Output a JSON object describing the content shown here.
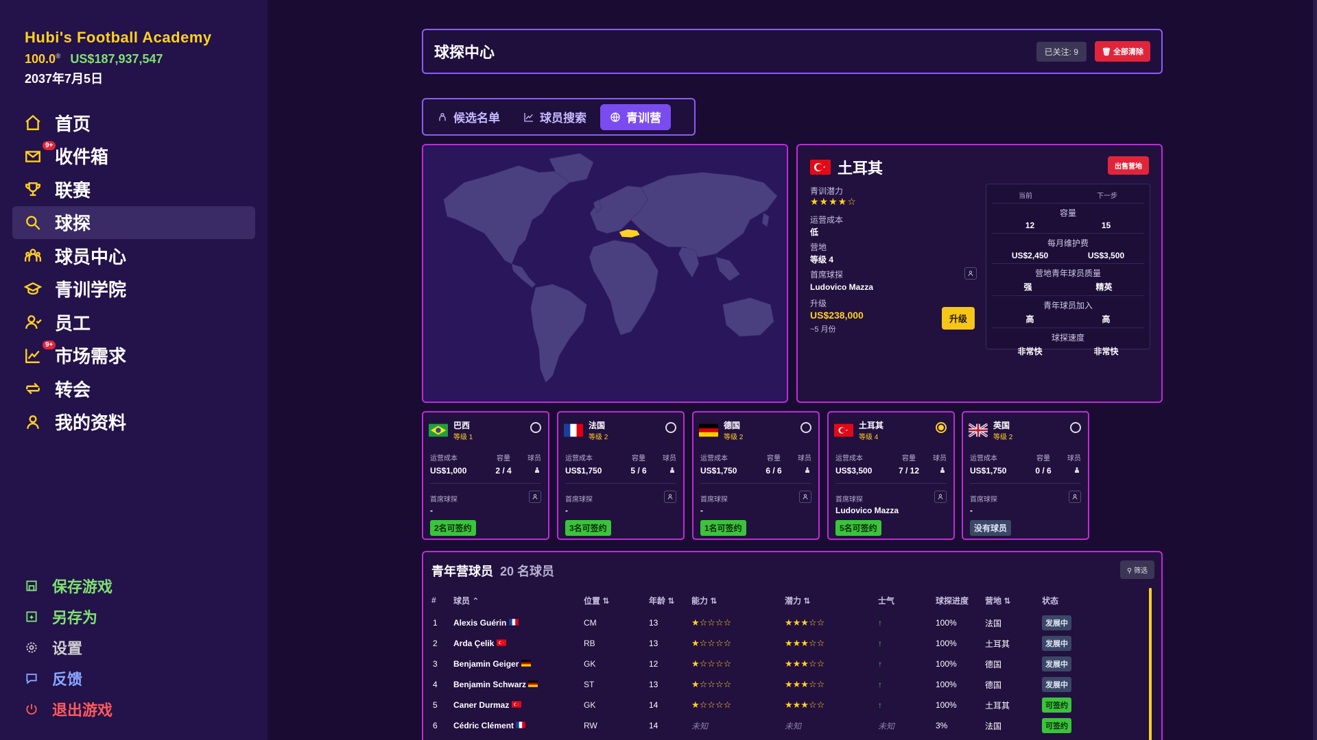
{
  "brand": {
    "title": "Hubi's Football Academy",
    "reputation": "100.0",
    "money": "US$187,937,547",
    "date": "2037年7月5日"
  },
  "nav": [
    {
      "label": "首页",
      "icon": "home-icon"
    },
    {
      "label": "收件箱",
      "icon": "mail-icon",
      "badge": "9+"
    },
    {
      "label": "联赛",
      "icon": "trophy-icon"
    },
    {
      "label": "球探",
      "icon": "search-icon",
      "active": true
    },
    {
      "label": "球员中心",
      "icon": "users-icon"
    },
    {
      "label": "青训学院",
      "icon": "graduation-icon"
    },
    {
      "label": "员工",
      "icon": "staff-icon"
    },
    {
      "label": "市场需求",
      "icon": "chart-icon",
      "badge": "9+"
    },
    {
      "label": "转会",
      "icon": "transfer-icon"
    },
    {
      "label": "我的资料",
      "icon": "profile-icon"
    }
  ],
  "bottom_nav": {
    "save": "保存游戏",
    "save_as": "另存为",
    "settings": "设置",
    "feedback": "反馈",
    "quit": "退出游戏"
  },
  "header": {
    "title": "球探中心",
    "followed": "已关注: 9",
    "clear_all": "全部清除"
  },
  "tabs": {
    "shortlist": "候选名单",
    "player_search": "球员搜索",
    "youth_camp": "青训营"
  },
  "detail": {
    "country": "土耳其",
    "sell": "出售营地",
    "potential_label": "青训潜力",
    "potential_stars": "★★★★☆",
    "cost_label": "运营成本",
    "cost_value": "低",
    "camp_label": "营地",
    "camp_value": "等级 4",
    "scout_label": "首席球探",
    "scout_value": "Ludovico Mazza",
    "upgrade_label": "升级",
    "upgrade_cost": "US$238,000",
    "upgrade_time": "~5 月份",
    "upgrade_btn": "升级",
    "cmp": {
      "current": "当前",
      "next": "下一步",
      "rows": [
        {
          "label": "容量",
          "cur": "12",
          "next": "15"
        },
        {
          "label": "每月维护费",
          "cur": "US$2,450",
          "next": "US$3,500"
        },
        {
          "label": "营地青年球员质量",
          "cur": "强",
          "next": "精英"
        },
        {
          "label": "青年球员加入",
          "cur": "高",
          "next": "高"
        },
        {
          "label": "球探速度",
          "cur": "非常快",
          "next": "非常快"
        }
      ]
    }
  },
  "card_labels": {
    "cost": "运营成本",
    "capacity": "容量",
    "players": "球员",
    "scout": "首席球探"
  },
  "cards": [
    {
      "name": "巴西",
      "level": "等级 1",
      "cost": "US$1,000",
      "capacity": "2 / 4",
      "scout": "-",
      "tag": "2名可签约",
      "tag_type": "green",
      "flag": "br"
    },
    {
      "name": "法国",
      "level": "等级 2",
      "cost": "US$1,750",
      "capacity": "5 / 6",
      "scout": "-",
      "tag": "3名可签约",
      "tag_type": "green",
      "flag": "fr"
    },
    {
      "name": "德国",
      "level": "等级 2",
      "cost": "US$1,750",
      "capacity": "6 / 6",
      "scout": "-",
      "tag": "1名可签约",
      "tag_type": "green",
      "flag": "de"
    },
    {
      "name": "土耳其",
      "level": "等级 4",
      "cost": "US$3,500",
      "capacity": "7 / 12",
      "scout": "Ludovico Mazza",
      "tag": "5名可签约",
      "tag_type": "green",
      "flag": "tr",
      "selected": true
    },
    {
      "name": "英国",
      "level": "等级 2",
      "cost": "US$1,750",
      "capacity": "0 / 6",
      "scout": "-",
      "tag": "没有球员",
      "tag_type": "gray",
      "flag": "gb"
    }
  ],
  "table": {
    "title": "青年营球员",
    "count": "20 名球员",
    "filter": "筛选",
    "headers": {
      "num": "#",
      "player": "球员 ⌃",
      "position": "位置 ⇅",
      "age": "年龄 ⇅",
      "ability": "能力 ⇅",
      "potential": "潜力 ⇅",
      "morale": "士气",
      "progress": "球探进度",
      "camp": "营地 ⇅",
      "status": "状态"
    },
    "rows": [
      {
        "num": "1",
        "name": "Alexis Guérin",
        "flag": "fr",
        "pos": "CM",
        "age": "13",
        "ability": "★☆☆☆☆",
        "potential": "★★★☆☆",
        "morale": "↑",
        "progress": "100%",
        "camp": "法国",
        "status": "发展中",
        "status_type": "dev"
      },
      {
        "num": "2",
        "name": "Arda Çelik",
        "flag": "tr",
        "pos": "RB",
        "age": "13",
        "ability": "★☆☆☆☆",
        "potential": "★★★☆☆",
        "morale": "↑",
        "progress": "100%",
        "camp": "土耳其",
        "status": "发展中",
        "status_type": "dev"
      },
      {
        "num": "3",
        "name": "Benjamin Geiger",
        "flag": "de",
        "pos": "GK",
        "age": "12",
        "ability": "★☆☆☆☆",
        "potential": "★★★☆☆",
        "morale": "↑",
        "progress": "100%",
        "camp": "德国",
        "status": "发展中",
        "status_type": "dev"
      },
      {
        "num": "4",
        "name": "Benjamin Schwarz",
        "flag": "de",
        "pos": "ST",
        "age": "13",
        "ability": "★☆☆☆☆",
        "potential": "★★★☆☆",
        "morale": "↑",
        "progress": "100%",
        "camp": "德国",
        "status": "发展中",
        "status_type": "dev"
      },
      {
        "num": "5",
        "name": "Caner Durmaz",
        "flag": "tr",
        "pos": "GK",
        "age": "14",
        "ability": "★☆☆☆☆",
        "potential": "★★★☆☆",
        "morale": "↑",
        "progress": "100%",
        "camp": "土耳其",
        "status": "可签约",
        "status_type": "ok"
      },
      {
        "num": "6",
        "name": "Cédric Clément",
        "flag": "fr",
        "pos": "RW",
        "age": "14",
        "ability": "未知",
        "potential": "未知",
        "morale": "未知",
        "progress": "3%",
        "camp": "法国",
        "status": "可签约",
        "status_type": "ok"
      }
    ]
  },
  "colors": {
    "accent": "#ffd21f",
    "border": "#c12bd8",
    "header_border": "#8e5cf7",
    "danger": "#e0253b",
    "success": "#3ac43a"
  }
}
